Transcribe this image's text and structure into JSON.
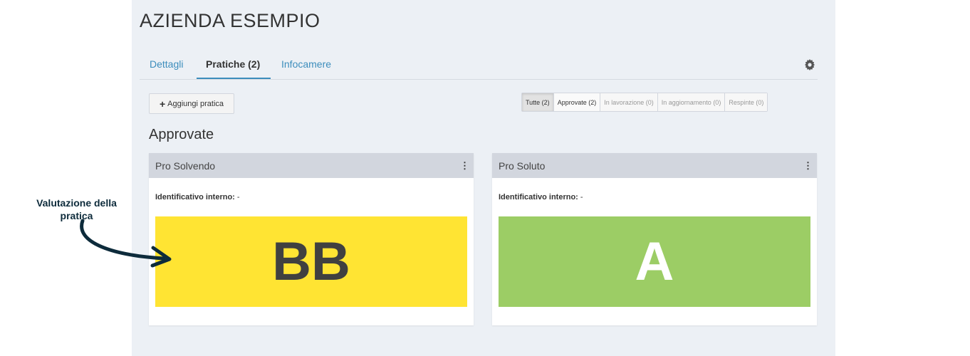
{
  "company": {
    "title": "AZIENDA ESEMPIO"
  },
  "tabs": [
    {
      "label": "Dettagli"
    },
    {
      "label": "Pratiche (2)"
    },
    {
      "label": "Infocamere"
    }
  ],
  "toolbar": {
    "add_label": "Aggiungi pratica",
    "add_icon": "plus-icon",
    "settings_icon": "gear-icon"
  },
  "filters": [
    {
      "label": "Tutte (2)"
    },
    {
      "label": "Approvate (2)"
    },
    {
      "label": "In lavorazione (0)"
    },
    {
      "label": "In aggiornamento (0)"
    },
    {
      "label": "Respinte (0)"
    }
  ],
  "section": {
    "heading": "Approvate"
  },
  "cards": [
    {
      "title": "Pro Solvendo",
      "id_label": "Identificativo interno:",
      "id_value": "-",
      "rating": "BB",
      "rating_color": "#ffe433",
      "rating_text_color": "#404040"
    },
    {
      "title": "Pro Soluto",
      "id_label": "Identificativo interno:",
      "id_value": "-",
      "rating": "A",
      "rating_color": "#9ccd65",
      "rating_text_color": "#ffffff"
    }
  ],
  "annotation": {
    "line1": "Valutazione della",
    "line2": "pratica",
    "color": "#0d2b3b"
  }
}
